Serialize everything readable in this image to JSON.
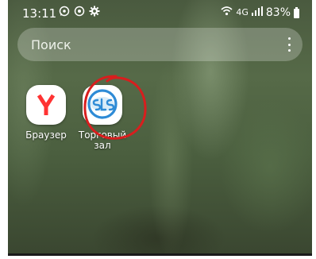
{
  "status_bar": {
    "time": "13:11",
    "notification_icons": [
      "whatsapp-icon",
      "vpn-icon",
      "settings-icon"
    ],
    "network_type": "4G",
    "battery": "83%"
  },
  "search": {
    "placeholder": "Поиск"
  },
  "apps": [
    {
      "label": "Браузер",
      "icon": "yandex-browser-icon"
    },
    {
      "label": "Торговый зал",
      "icon": "sls-icon"
    }
  ],
  "colors": {
    "yandex_red": "#FF3333",
    "sls_blue": "#2E8BD6",
    "annotation_red": "#D81E1E"
  }
}
